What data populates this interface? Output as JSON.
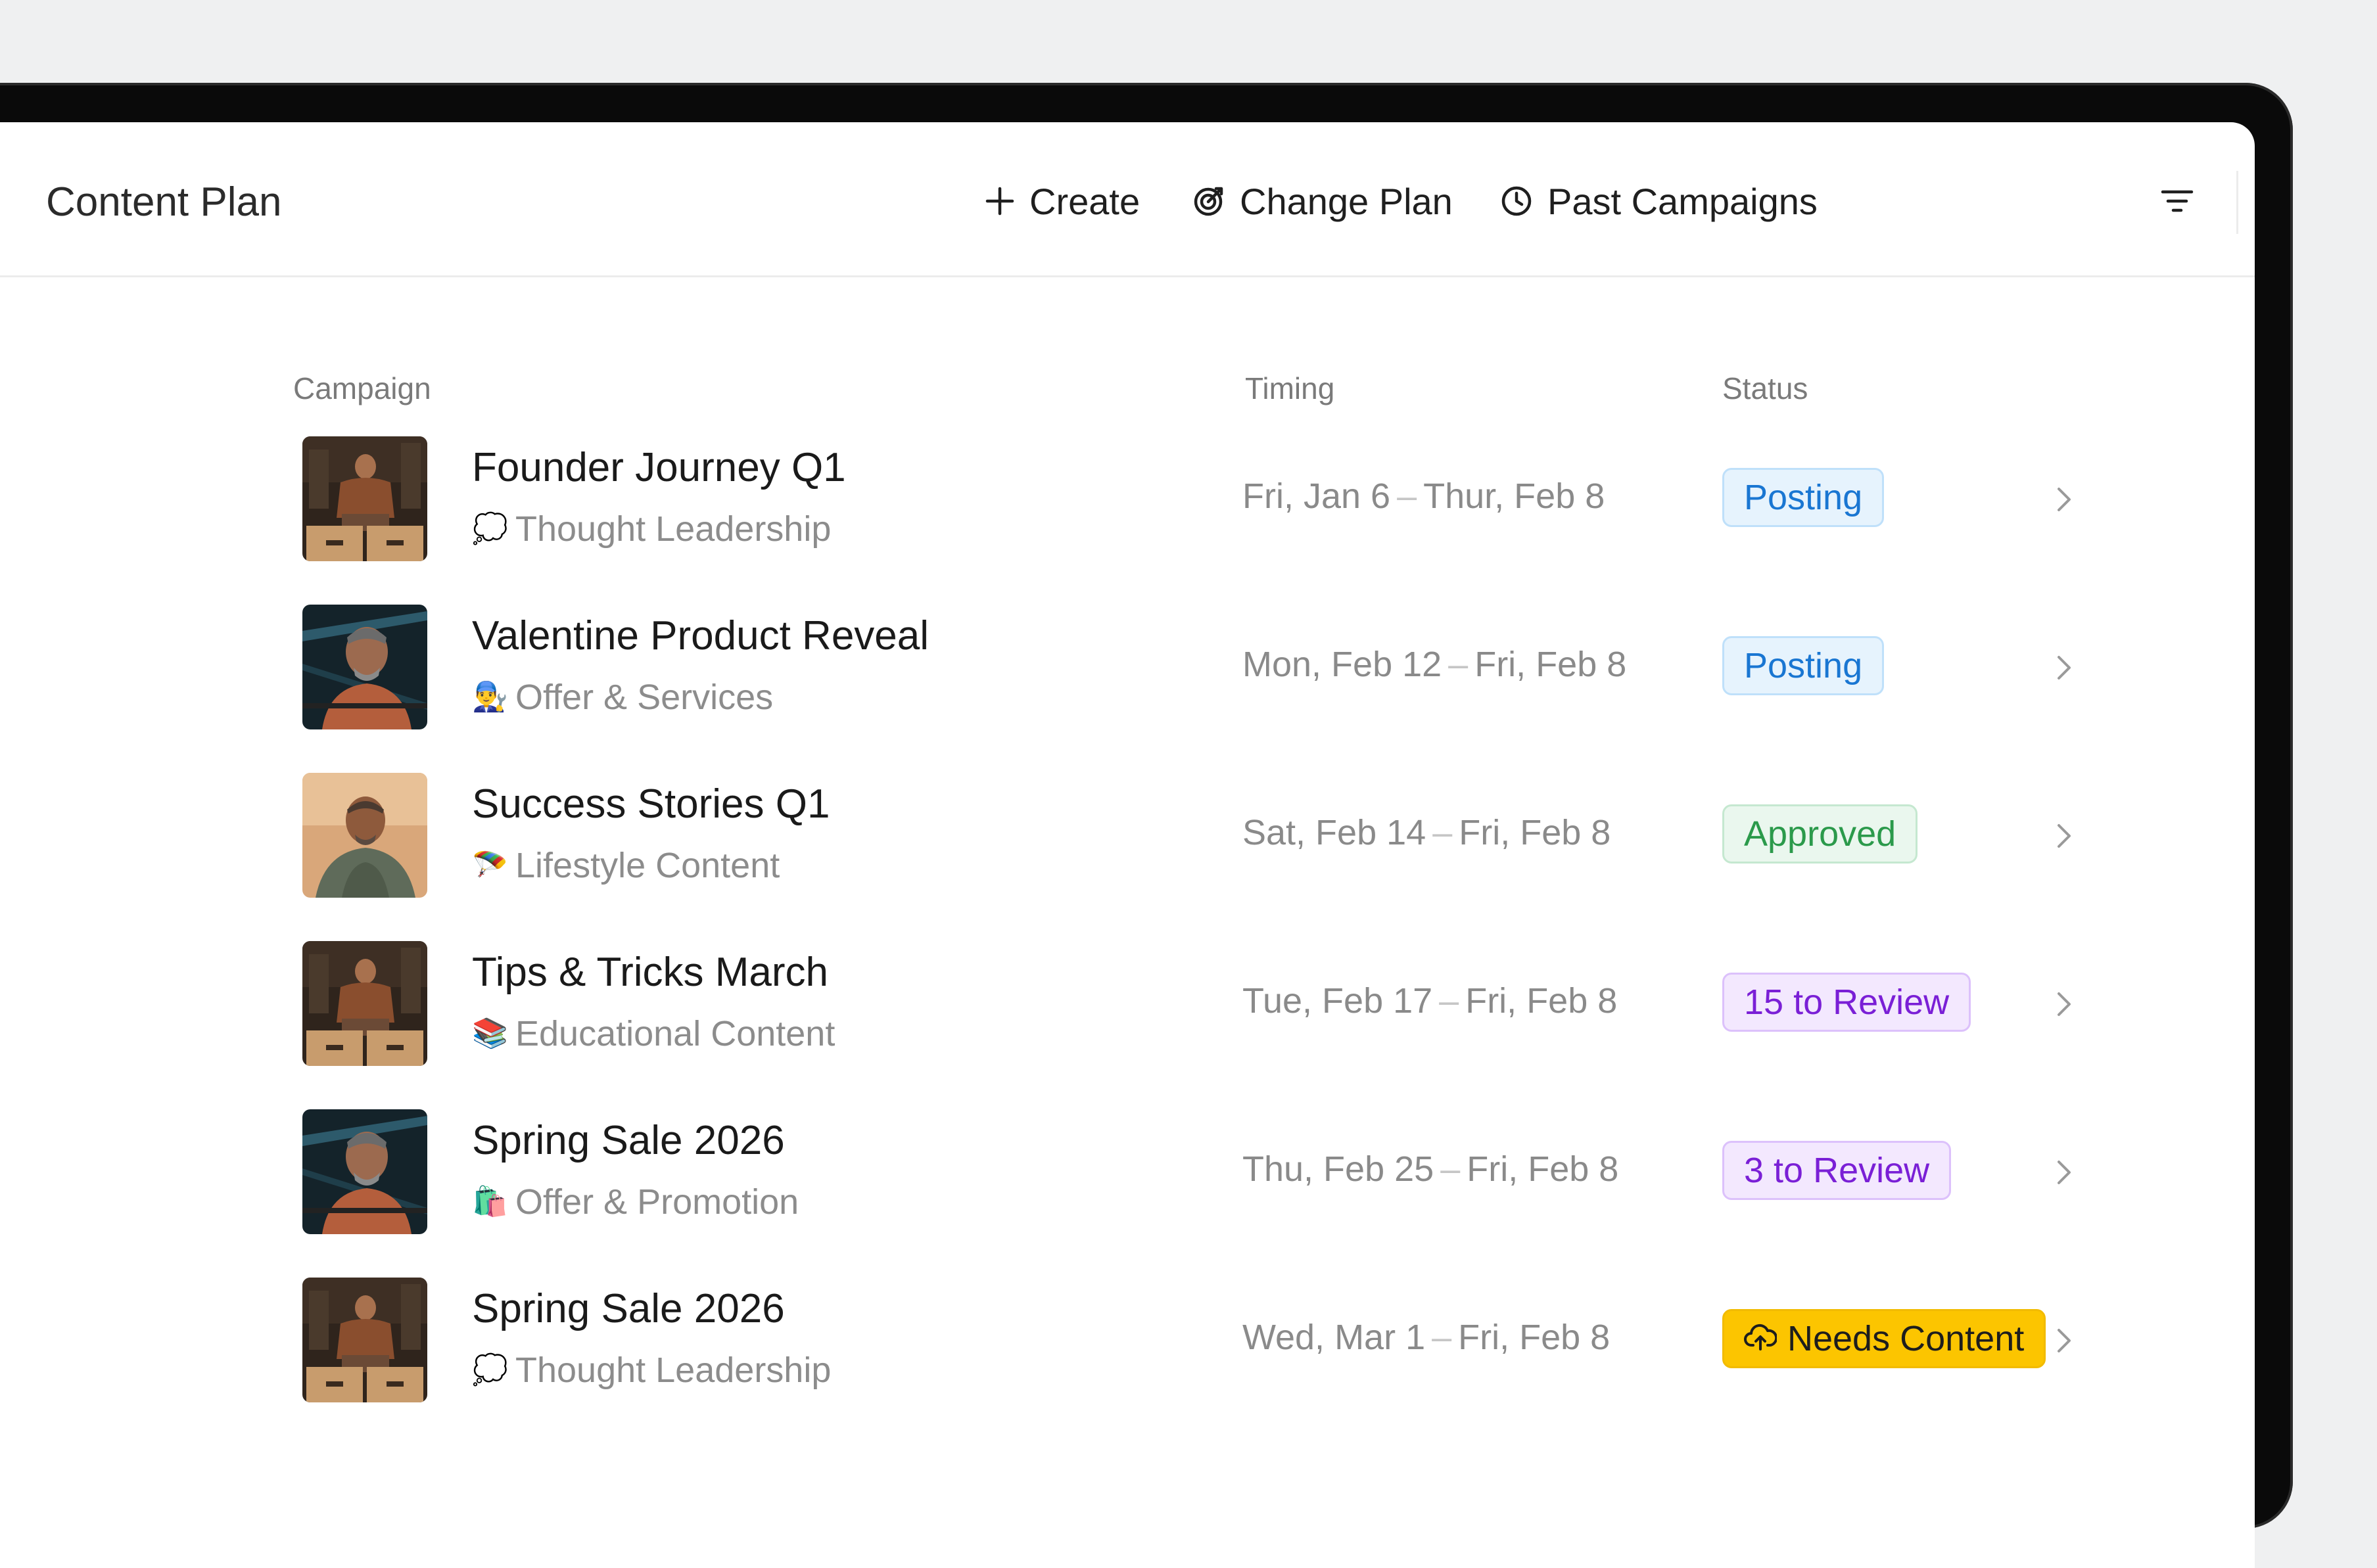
{
  "toolbar": {
    "title": "Content Plan",
    "create_label": "Create",
    "change_plan_label": "Change Plan",
    "past_campaigns_label": "Past Campaigns"
  },
  "table": {
    "headers": {
      "campaign": "Campaign",
      "timing": "Timing",
      "status": "Status"
    },
    "rows": [
      {
        "title": "Founder Journey Q1",
        "category_emoji": "💭",
        "category": "Thought Leadership",
        "start": "Fri, Jan 6",
        "separator": "–",
        "end": "Thur, Feb 8",
        "status": "Posting",
        "status_type": "posting",
        "thumb": "box-jump"
      },
      {
        "title": "Valentine Product Reveal",
        "category_emoji": "👨‍🔧",
        "category": "Offer & Services",
        "start": "Mon, Feb 12",
        "separator": "–",
        "end": "Fri, Feb 8",
        "status": "Posting",
        "status_type": "posting",
        "thumb": "rope-pull"
      },
      {
        "title": "Success Stories Q1",
        "category_emoji": "🪂",
        "category": "Lifestyle Content",
        "start": "Sat, Feb 14",
        "separator": "–",
        "end": "Fri, Feb 8",
        "status": "Approved",
        "status_type": "approved",
        "thumb": "portrait"
      },
      {
        "title": "Tips & Tricks March",
        "category_emoji": "📚",
        "category": "Educational Content",
        "start": "Tue, Feb 17",
        "separator": "–",
        "end": "Fri, Feb 8",
        "status": "15 to Review",
        "status_type": "review",
        "thumb": "box-jump"
      },
      {
        "title": "Spring Sale 2026",
        "category_emoji": "🛍️",
        "category": "Offer & Promotion",
        "start": "Thu, Feb 25",
        "separator": "–",
        "end": "Fri, Feb 8",
        "status": "3 to Review",
        "status_type": "review",
        "thumb": "rope-pull"
      },
      {
        "title": "Spring Sale 2026",
        "category_emoji": "💭",
        "category": "Thought Leadership",
        "start": "Wed, Mar 1",
        "separator": "–",
        "end": "Fri, Feb 8",
        "status": "Needs Content",
        "status_type": "needs",
        "status_icon": "cloud-upload-icon",
        "thumb": "box-jump"
      }
    ]
  },
  "colors": {
    "posting": "#1976d2",
    "approved": "#2b9a4b",
    "review": "#7a1fd6",
    "needs_content_bg": "#fcc500"
  }
}
